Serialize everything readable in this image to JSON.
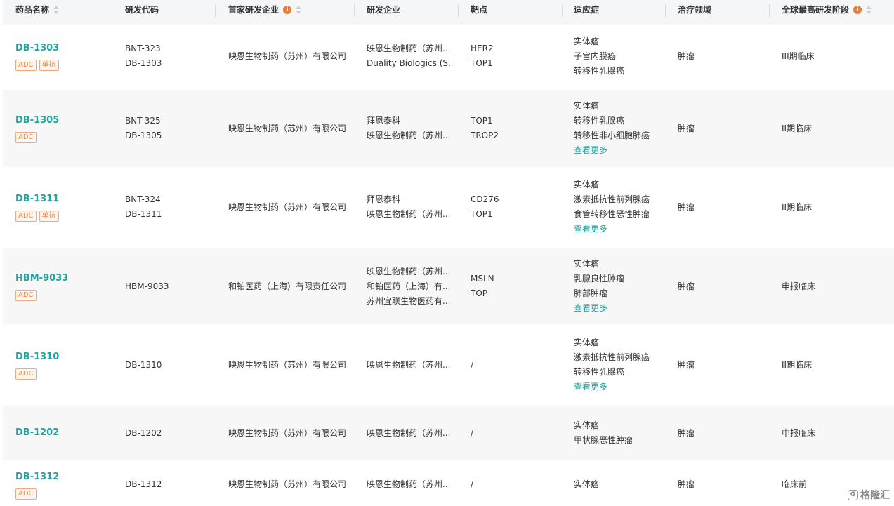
{
  "columns": [
    {
      "key": "drug",
      "label": "药品名称",
      "sort": true,
      "info": false
    },
    {
      "key": "code",
      "label": "研发代码",
      "sort": false,
      "info": false
    },
    {
      "key": "first_company",
      "label": "首家研发企业",
      "sort": true,
      "info": true
    },
    {
      "key": "companies",
      "label": "研发企业",
      "sort": false,
      "info": false
    },
    {
      "key": "targets",
      "label": "靶点",
      "sort": false,
      "info": false
    },
    {
      "key": "indications",
      "label": "适应症",
      "sort": false,
      "info": false
    },
    {
      "key": "area",
      "label": "治疗领域",
      "sort": false,
      "info": false
    },
    {
      "key": "stage",
      "label": "全球最高研发阶段",
      "sort": true,
      "info": true
    }
  ],
  "info_glyph": "i",
  "more_label": "查看更多",
  "accent_color": "#21a3a0",
  "tag_color": "#ef8a4c",
  "rows": [
    {
      "drug": "DB-1303",
      "tags": [
        "ADC",
        "单抗"
      ],
      "codes": [
        "BNT-323",
        "DB-1303"
      ],
      "first_company": "映恩生物制药（苏州）有限公司",
      "companies": [
        "映恩生物制药（苏州...",
        "Duality Biologics (S..."
      ],
      "targets": [
        "HER2",
        "TOP1"
      ],
      "indications": [
        "实体瘤",
        "子宫内膜癌",
        "转移性乳腺癌"
      ],
      "more": false,
      "area": "肿瘤",
      "stage": "III期临床"
    },
    {
      "drug": "DB-1305",
      "tags": [
        "ADC"
      ],
      "codes": [
        "BNT-325",
        "DB-1305"
      ],
      "first_company": "映恩生物制药（苏州）有限公司",
      "companies": [
        "拜恩泰科",
        "映恩生物制药（苏州..."
      ],
      "targets": [
        "TOP1",
        "TROP2"
      ],
      "indications": [
        "实体瘤",
        "转移性乳腺癌",
        "转移性非小细胞肺癌"
      ],
      "more": true,
      "area": "肿瘤",
      "stage": "II期临床"
    },
    {
      "drug": "DB-1311",
      "tags": [
        "ADC",
        "单抗"
      ],
      "codes": [
        "BNT-324",
        "DB-1311"
      ],
      "first_company": "映恩生物制药（苏州）有限公司",
      "companies": [
        "拜恩泰科",
        "映恩生物制药（苏州..."
      ],
      "targets": [
        "CD276",
        "TOP1"
      ],
      "indications": [
        "实体瘤",
        "激素抵抗性前列腺癌",
        "食管转移性恶性肿瘤"
      ],
      "more": true,
      "area": "肿瘤",
      "stage": "II期临床"
    },
    {
      "drug": "HBM-9033",
      "tags": [
        "ADC"
      ],
      "codes": [
        "HBM-9033"
      ],
      "first_company": "和铂医药（上海）有限责任公司",
      "companies": [
        "映恩生物制药（苏州...",
        "和铂医药（上海）有...",
        "苏州宜联生物医药有..."
      ],
      "targets": [
        "MSLN",
        "TOP"
      ],
      "indications": [
        "实体瘤",
        "乳腺良性肿瘤",
        "肺部肿瘤"
      ],
      "more": true,
      "area": "肿瘤",
      "stage": "申报临床"
    },
    {
      "drug": "DB-1310",
      "tags": [
        "ADC"
      ],
      "codes": [
        "DB-1310"
      ],
      "first_company": "映恩生物制药（苏州）有限公司",
      "companies": [
        "映恩生物制药（苏州..."
      ],
      "targets": [
        "/"
      ],
      "indications": [
        "实体瘤",
        "激素抵抗性前列腺癌",
        "转移性乳腺癌"
      ],
      "more": true,
      "area": "肿瘤",
      "stage": "II期临床"
    },
    {
      "drug": "DB-1202",
      "tags": [],
      "codes": [
        "DB-1202"
      ],
      "first_company": "映恩生物制药（苏州）有限公司",
      "companies": [
        "映恩生物制药（苏州..."
      ],
      "targets": [
        "/"
      ],
      "indications": [
        "实体瘤",
        "甲状腺恶性肿瘤"
      ],
      "more": false,
      "area": "肿瘤",
      "stage": "申报临床"
    },
    {
      "drug": "DB-1312",
      "tags": [
        "ADC"
      ],
      "codes": [
        "DB-1312"
      ],
      "first_company": "映恩生物制药（苏州）有限公司",
      "companies": [
        "映恩生物制药（苏州..."
      ],
      "targets": [
        "/"
      ],
      "indications": [
        "实体瘤"
      ],
      "more": false,
      "area": "肿瘤",
      "stage": "临床前"
    }
  ],
  "watermark": {
    "logo": "G",
    "text": "格隆汇"
  }
}
